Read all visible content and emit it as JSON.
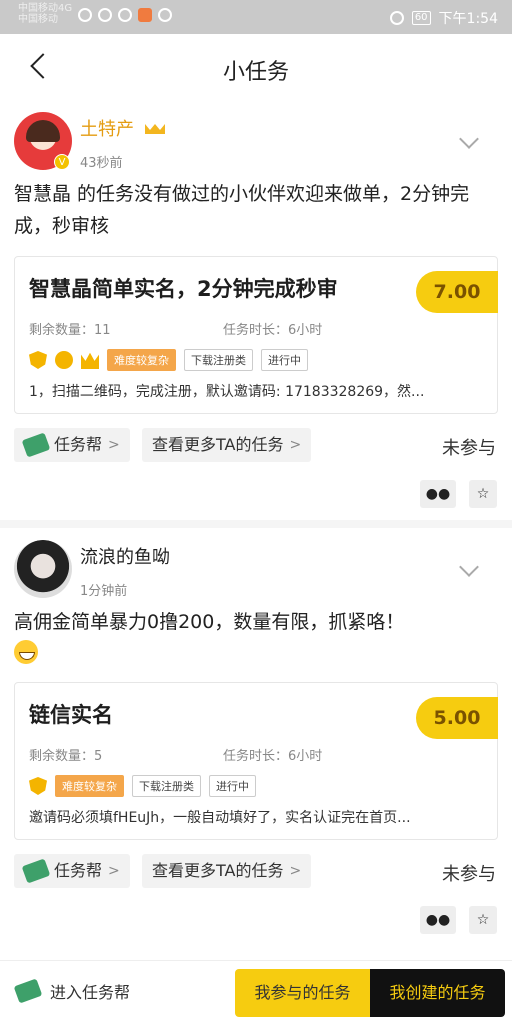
{
  "status_bar": {
    "carrier_line1": "中国移动4G",
    "carrier_line2": "中国移动",
    "network": "4G",
    "battery": "60",
    "time": "下午1:54"
  },
  "nav": {
    "title": "小任务"
  },
  "posts": [
    {
      "user": "土特产",
      "time_ago": "43秒前",
      "desc": "智慧晶 的任务没有做过的小伙伴欢迎来做单，2分钟完成，秒审核",
      "card": {
        "title": "智慧晶简单实名，2分钟完成秒审",
        "price": "7.00",
        "remaining": "剩余数量：11",
        "duration": "任务时长：6小时",
        "tags": [
          "难度较复杂",
          "下载注册类",
          "进行中"
        ],
        "desc": "1，扫描二维码，完成注册，默认邀请码: 17183328269，然..."
      },
      "chip_1": "任务帮",
      "chip_2": "查看更多TA的任务",
      "status": "未参与"
    },
    {
      "user": "流浪的鱼呦",
      "time_ago": "1分钟前",
      "desc": "高佣金简单暴力0撸200，数量有限，抓紧咯！",
      "card": {
        "title": "链信实名",
        "price": "5.00",
        "remaining": "剩余数量：5",
        "duration": "任务时长：6小时",
        "tags": [
          "难度较复杂",
          "下载注册类",
          "进行中"
        ],
        "desc": "邀请码必须填fHEuJh，一般自动填好了，实名认证完在首页..."
      },
      "chip_1": "任务帮",
      "chip_2": "查看更多TA的任务",
      "status": "未参与"
    }
  ],
  "bottom": {
    "enter_label": "进入任务帮",
    "my_participated": "我参与的任务",
    "my_created": "我创建的任务"
  }
}
